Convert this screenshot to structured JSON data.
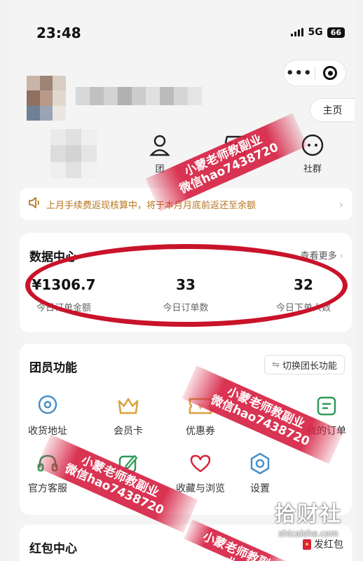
{
  "status_bar": {
    "time": "23:48",
    "network": "5G",
    "battery": "66"
  },
  "header": {
    "home_button": "主页"
  },
  "nav": [
    {
      "label": "团",
      "icon": "user-icon"
    },
    {
      "label": "",
      "icon": "store-icon"
    },
    {
      "label": "社群",
      "icon": "chat-icon"
    }
  ],
  "notice": {
    "text": "上月手续费返现核算中，将于本月月底前返还至余额",
    "icon": "speaker-icon"
  },
  "data_center": {
    "title": "数据中心",
    "more": "查看更多",
    "stats": [
      {
        "value": "¥1306.7",
        "label": "今日订单金额"
      },
      {
        "value": "33",
        "label": "今日订单数"
      },
      {
        "value": "32",
        "label": "今日下单人数"
      }
    ]
  },
  "member_functions": {
    "title": "团员功能",
    "switch_label": "切换团长功能",
    "items": [
      {
        "label": "收货地址",
        "icon": "location-icon"
      },
      {
        "label": "会员卡",
        "icon": "crown-icon"
      },
      {
        "label": "优惠券",
        "icon": "coupon-icon"
      },
      {
        "label": "我的订单",
        "icon": "order-icon"
      },
      {
        "label": "官方客服",
        "icon": "headset-icon"
      },
      {
        "label": "",
        "icon": "edit-icon"
      },
      {
        "label": "收藏与浏览",
        "icon": "heart-icon"
      },
      {
        "label": "设置",
        "icon": "settings-icon"
      }
    ]
  },
  "red_packet": {
    "title": "红包中心",
    "button": "发红包"
  },
  "watermark": {
    "line1": "小蒙老师教副业",
    "line2": "微信hao7438720"
  },
  "brand_watermark": {
    "name": "拾财社",
    "site": "shicaishe.com"
  },
  "colors": {
    "accent": "#c9132a",
    "icon_blue": "#4a90c8",
    "icon_gold": "#d9a23c",
    "icon_green": "#2e9a5a",
    "icon_red": "#d8233a",
    "notice_text": "#b8761f"
  }
}
